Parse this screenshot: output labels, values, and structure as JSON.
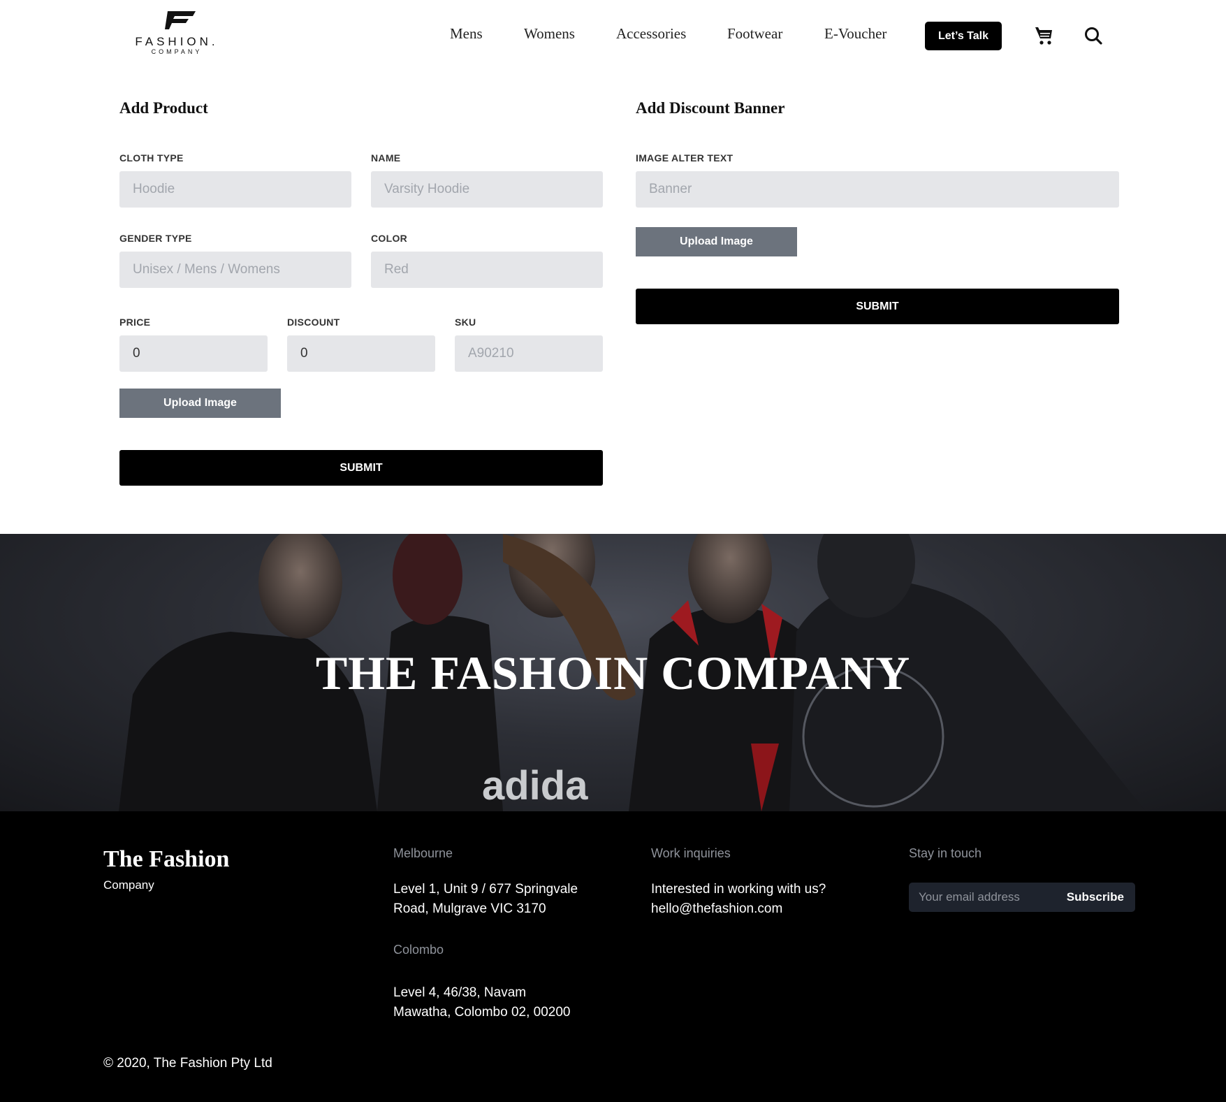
{
  "header": {
    "logo": {
      "word": "FASHION.",
      "sub": "COMPANY"
    },
    "nav": [
      "Mens",
      "Womens",
      "Accessories",
      "Footwear",
      "E-Voucher"
    ],
    "cta_label": "Let’s Talk",
    "icons": [
      "cart-icon",
      "search-icon"
    ]
  },
  "product_form": {
    "title": "Add Product",
    "cloth_type": {
      "label": "CLOTH TYPE",
      "placeholder": "Hoodie"
    },
    "name": {
      "label": "NAME",
      "placeholder": "Varsity Hoodie"
    },
    "gender_type": {
      "label": "GENDER TYPE",
      "placeholder": "Unisex / Mens / Womens"
    },
    "color": {
      "label": "COLOR",
      "placeholder": "Red"
    },
    "price": {
      "label": "PRICE",
      "value": "0"
    },
    "discount": {
      "label": "DISCOUNT",
      "value": "0"
    },
    "sku": {
      "label": "SKU",
      "placeholder": "A90210"
    },
    "upload_label": "Upload Image",
    "submit_label": "SUBMIT"
  },
  "banner_form": {
    "title": "Add Discount Banner",
    "alt_text": {
      "label": "IMAGE ALTER TEXT",
      "placeholder": "Banner"
    },
    "upload_label": "Upload Image",
    "submit_label": "SUBMIT"
  },
  "hero": {
    "title": "THE FASHOIN COMPANY",
    "shirt_text": "adida"
  },
  "footer": {
    "brand": "The Fashion",
    "brand_sub": "Company",
    "melbourne": {
      "heading": "Melbourne",
      "line1": "Level 1, Unit 9 / 677 Springvale",
      "line2": "Road, Mulgrave VIC 3170"
    },
    "colombo": {
      "heading": "Colombo",
      "line1": "Level 4, 46/38, Navam",
      "line2": "Mawatha, Colombo 02, 00200"
    },
    "work": {
      "heading": "Work inquiries",
      "line1": "Interested in working with us?",
      "line2": "hello@thefashion.com"
    },
    "stay": {
      "heading": "Stay in touch",
      "email_placeholder": "Your email address",
      "subscribe_label": "Subscribe"
    },
    "copyright": "© 2020, The Fashion Pty Ltd"
  },
  "colors": {
    "accent": "#000000",
    "input_bg": "#e5e6e9",
    "upload_bg": "#6c737d",
    "footer_bg": "#000000"
  }
}
